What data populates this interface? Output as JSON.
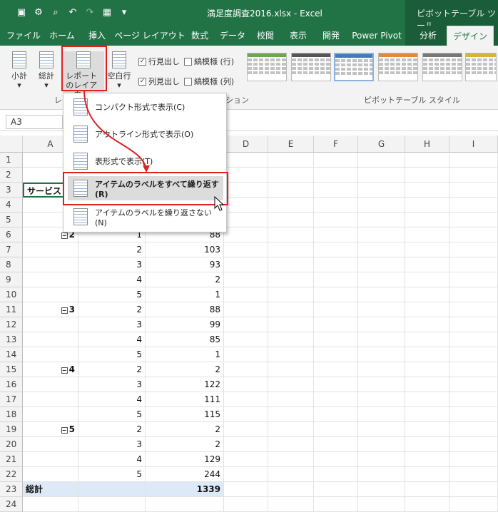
{
  "window": {
    "title": "満足度調査2016.xlsx - Excel",
    "context_title": "ピボットテーブル ツール"
  },
  "tabs": [
    {
      "label": "ファイル"
    },
    {
      "label": "ホーム"
    },
    {
      "label": "挿入"
    },
    {
      "label": "ページ レイアウト"
    },
    {
      "label": "数式"
    },
    {
      "label": "データ"
    },
    {
      "label": "校閲"
    },
    {
      "label": "表示"
    },
    {
      "label": "開発"
    },
    {
      "label": "Power Pivot"
    },
    {
      "label": "分析"
    },
    {
      "label": "デザイン"
    }
  ],
  "ribbon": {
    "subtotal": "小計",
    "grandtotal": "総計",
    "report_layout": "レポートのレイアウト",
    "blank_rows": "空白行",
    "group_layout": "レイ",
    "row_headers": "行見出し",
    "banded_rows": "縞模様 (行)",
    "col_headers": "列見出し",
    "banded_cols": "縞模様 (列)",
    "group_options": "ション",
    "group_styles": "ピボットテーブル スタイル"
  },
  "namebox": "A3",
  "columns": [
    "A",
    "B",
    "C",
    "D",
    "E",
    "F",
    "G",
    "H",
    "I"
  ],
  "rows": [
    {
      "n": "1",
      "a": "",
      "b": "",
      "c": ""
    },
    {
      "n": "2",
      "a": "",
      "b": "",
      "c": ""
    },
    {
      "n": "3",
      "a": "サービス",
      "b": "",
      "c": ""
    },
    {
      "n": "4",
      "a": "",
      "b": "",
      "c": ""
    },
    {
      "n": "5",
      "a": "",
      "b": "",
      "c": ""
    },
    {
      "n": "6",
      "a": "2",
      "b": "1",
      "c": "88"
    },
    {
      "n": "7",
      "a": "",
      "b": "2",
      "c": "103"
    },
    {
      "n": "8",
      "a": "",
      "b": "3",
      "c": "93"
    },
    {
      "n": "9",
      "a": "",
      "b": "4",
      "c": "2"
    },
    {
      "n": "10",
      "a": "",
      "b": "5",
      "c": "1"
    },
    {
      "n": "11",
      "a": "3",
      "b": "2",
      "c": "88"
    },
    {
      "n": "12",
      "a": "",
      "b": "3",
      "c": "99"
    },
    {
      "n": "13",
      "a": "",
      "b": "4",
      "c": "85"
    },
    {
      "n": "14",
      "a": "",
      "b": "5",
      "c": "1"
    },
    {
      "n": "15",
      "a": "4",
      "b": "2",
      "c": "2"
    },
    {
      "n": "16",
      "a": "",
      "b": "3",
      "c": "122"
    },
    {
      "n": "17",
      "a": "",
      "b": "4",
      "c": "111"
    },
    {
      "n": "18",
      "a": "",
      "b": "5",
      "c": "115"
    },
    {
      "n": "19",
      "a": "5",
      "b": "2",
      "c": "2"
    },
    {
      "n": "20",
      "a": "",
      "b": "3",
      "c": "2"
    },
    {
      "n": "21",
      "a": "",
      "b": "4",
      "c": "129"
    },
    {
      "n": "22",
      "a": "",
      "b": "5",
      "c": "244"
    },
    {
      "n": "23",
      "a": "総計",
      "b": "",
      "c": "1339"
    },
    {
      "n": "24",
      "a": "",
      "b": "",
      "c": ""
    }
  ],
  "menu": {
    "items": [
      {
        "label": "コンパクト形式で表示(C)"
      },
      {
        "label": "アウトライン形式で表示(O)"
      },
      {
        "label": "表形式で表示(T)"
      },
      {
        "label": "アイテムのラベルをすべて繰り返す(R)"
      },
      {
        "label": "アイテムのラベルを繰り返さない(N)"
      }
    ]
  },
  "colors": {
    "excel_green": "#217346",
    "highlight_red": "#e02020",
    "total_row": "#dde9f6"
  }
}
